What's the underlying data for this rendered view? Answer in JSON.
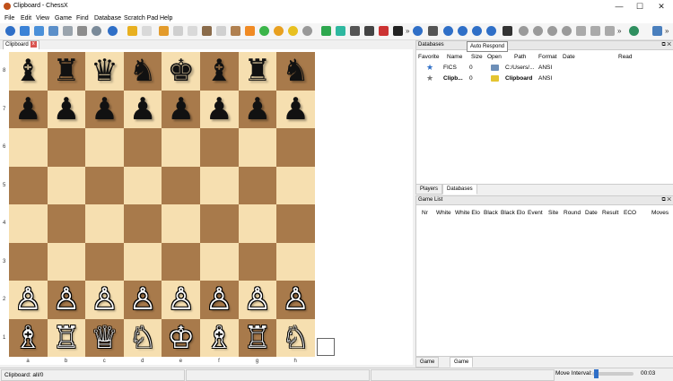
{
  "window": {
    "title": "Clipboard - ChessX",
    "controls": [
      "—",
      "☐",
      "✕"
    ]
  },
  "menu": [
    "File",
    "Edit",
    "View",
    "Game",
    "Find",
    "Database",
    "Scratch Pad",
    "Help"
  ],
  "toolbar": {
    "tooltip": "Auto Respond",
    "overflow_left": "»",
    "overflow_mid": "»",
    "overflow_right": "»",
    "icons": [
      "new-db",
      "open-db",
      "open-folder",
      "save",
      "print",
      "info",
      "undo",
      "redo",
      "edit",
      "brush",
      "key",
      "knight",
      "flip",
      "comment",
      "green-circle",
      "orange-circle",
      "yellow-circle",
      "gray-circle",
      "grid-view",
      "lightning",
      "board-a",
      "board-b",
      "flag-view",
      "piece-view",
      "face",
      "engine",
      "play",
      "auto-respond",
      "refresh",
      "phone",
      "start",
      "prev",
      "next",
      "end",
      "repeat",
      "up",
      "down",
      "globe",
      "search"
    ]
  },
  "board_tab": {
    "label": "Clipboard"
  },
  "board": {
    "ranks": [
      "8",
      "7",
      "6",
      "5",
      "4",
      "3",
      "2",
      "1"
    ],
    "files": [
      "a",
      "b",
      "c",
      "d",
      "e",
      "f",
      "g",
      "h"
    ],
    "position": [
      [
        "♝",
        "♜",
        "♛",
        "♞",
        "♚",
        "♝",
        "♜",
        "♞"
      ],
      [
        "♟",
        "♟",
        "♟",
        "♟",
        "♟",
        "♟",
        "♟",
        "♟"
      ],
      [
        "",
        "",
        "",
        "",
        "",
        "",
        "",
        ""
      ],
      [
        "",
        "",
        "",
        "",
        "",
        "",
        "",
        ""
      ],
      [
        "",
        "",
        "",
        "",
        "",
        "",
        "",
        ""
      ],
      [
        "",
        "",
        "",
        "",
        "",
        "",
        "",
        ""
      ],
      [
        "♙",
        "♙",
        "♙",
        "♙",
        "♙",
        "♙",
        "♙",
        "♙"
      ],
      [
        "♗",
        "♖",
        "♕",
        "♘",
        "♔",
        "♗",
        "♖",
        "♘"
      ]
    ]
  },
  "databases_panel": {
    "title": "Databases",
    "columns": [
      "Favorite",
      "Name",
      "Size",
      "Open",
      "Path",
      "Format",
      "Date",
      "Read"
    ],
    "rows": [
      {
        "favorite": "★",
        "star_color": "#2f6fc7",
        "name": "FICS",
        "size": "0",
        "open_color": "#6d8fb8",
        "path": "C:/Users/...",
        "format": "ANSI",
        "bold": false
      },
      {
        "favorite": "★",
        "star_color": "#777777",
        "name": "Clipb...",
        "size": "0",
        "open_color": "#e4c431",
        "path": "Clipboard",
        "format": "ANSI",
        "bold": true
      }
    ],
    "tabs": [
      "Players",
      "Databases"
    ]
  },
  "game_list_panel": {
    "title": "Game List",
    "columns": [
      "Nr",
      "White",
      "White Elo",
      "Black",
      "Black Elo",
      "Event",
      "Site",
      "Round",
      "Date",
      "Result",
      "ECO",
      "Moves"
    ],
    "tabs": [
      "Game Text",
      "Game List"
    ]
  },
  "status": {
    "left": "Clipboard: all/0",
    "move_interval_label": "Move Interval:",
    "move_interval_fraction": 0.05,
    "time": "00:03"
  },
  "colors": {
    "light_square": "#f6dfb0",
    "dark_square": "#a87a4b",
    "accent": "#2f6fc7"
  }
}
